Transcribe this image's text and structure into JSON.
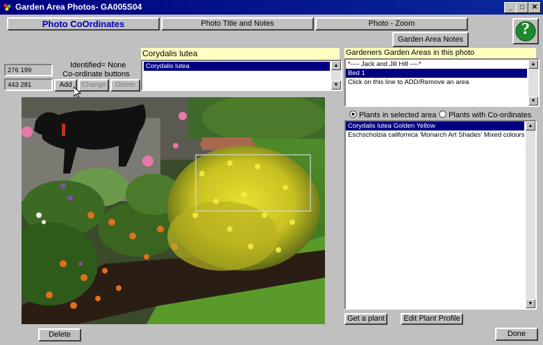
{
  "window": {
    "title": "Garden Area Photos- GA005S04",
    "min_glyph": "_",
    "max_glyph": "□",
    "close_glyph": "✕"
  },
  "tabs": [
    {
      "label": "Photo CoOrdinates",
      "active": true
    },
    {
      "label": "Photo Title and Notes",
      "active": false
    },
    {
      "label": "Photo - Zoom",
      "active": false
    }
  ],
  "garden_area_notes_label": "Garden Area Notes",
  "help_glyph": "?",
  "coords": {
    "first": "276 199",
    "second": "443 281",
    "identified_text": "Identified= None",
    "buttons_caption": "Co-ordinate buttons",
    "add_label": "Add",
    "change_label": "Change",
    "delete_label": "Delete"
  },
  "plant_header": "Corydalis lutea",
  "plant_list": [
    "Corydalis lutea"
  ],
  "areas": {
    "header": "Gardeners Garden Areas in this photo",
    "items": [
      {
        "text": "*---- Jack and Jill Hill ----*",
        "selected": false
      },
      {
        "text": "Bed 1",
        "selected": true
      },
      {
        "text": "Click on this line to ADD/Remove an area",
        "selected": false
      }
    ]
  },
  "plants_filter": {
    "option_selected_area": "Plants in selected area",
    "option_with_coords": "Plants with Co-ordinates",
    "selected": "selected_area"
  },
  "plants": [
    {
      "text": "Corydalis lutea   Golden  Yellow",
      "selected": true
    },
    {
      "text": "Eschscholzia californica  'Monarch Art Shades' Mixed colours",
      "selected": false
    }
  ],
  "get_plant_label": "Get a plant",
  "edit_profile_label": "Edit Plant Profile",
  "bottom_delete_label": "Delete",
  "done_label": "Done",
  "colors": {
    "title_bar": "#000080",
    "selection": "#000080",
    "active_tab_text": "#0000c0",
    "header_yellow": "#ffffc0",
    "help_green": "#1e8a2e"
  }
}
